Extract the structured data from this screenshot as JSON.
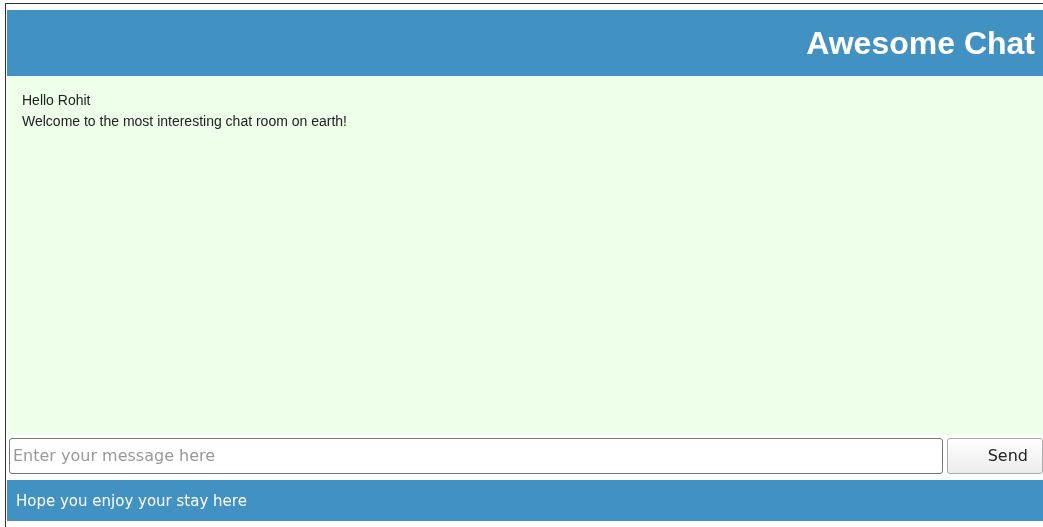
{
  "header": {
    "title": "Awesome Chat"
  },
  "messages": [
    "Hello Rohit",
    "Welcome to the most interesting chat room on earth!"
  ],
  "composer": {
    "placeholder": "Enter your message here",
    "button": "Send"
  },
  "footer": {
    "text": "Hope you enjoy your stay here"
  }
}
